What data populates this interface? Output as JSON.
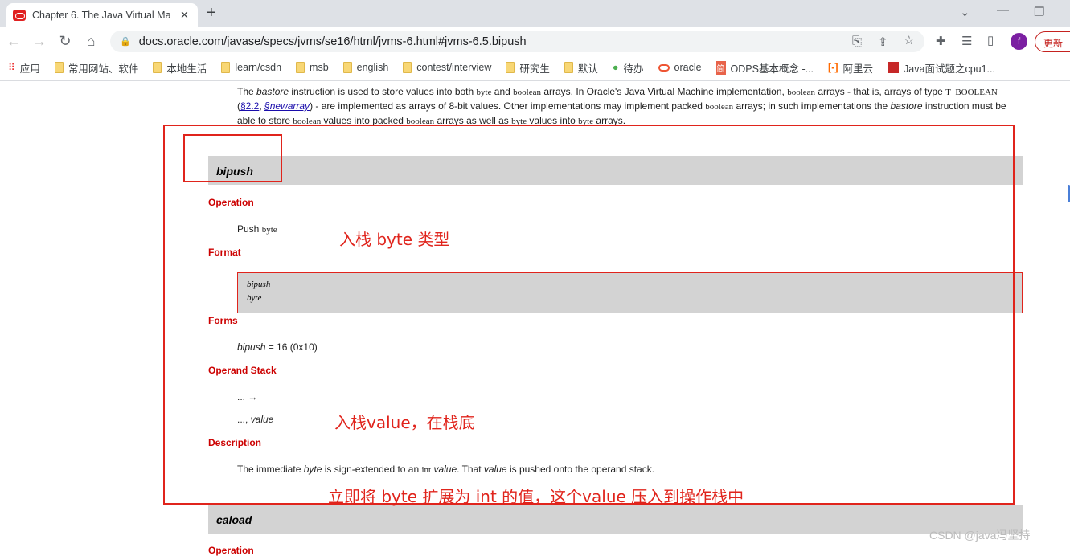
{
  "browser": {
    "tab_title": "Chapter 6. The Java Virtual Ma",
    "url": "docs.oracle.com/javase/specs/jvms/se16/html/jvms-6.html#jvms-6.5.bipush",
    "update_label": "更新",
    "profile_initial": "f",
    "bookmarks": [
      "应用",
      "常用网站、软件",
      "本地生活",
      "learn/csdn",
      "msb",
      "english",
      "contest/interview",
      "研究生",
      "默认",
      "待办",
      "oracle",
      "ODPS基本概念 -...",
      "阿里云",
      "Java面试题之cpu1..."
    ]
  },
  "page": {
    "intro": {
      "p1": "The ",
      "i1": "bastore",
      "p2": " instruction is used to store values into both ",
      "c1": "byte",
      "p3": " and ",
      "c2": "boolean",
      "p4": " arrays. In Oracle's Java Virtual Machine implementation, ",
      "c3": "boolean",
      "p5": " arrays - that is, arrays of type ",
      "c4": "T_BOOLEAN",
      "p6": " (",
      "l1": "§2.2",
      "p7": ", ",
      "l2": "§newarray",
      "p8": ") - are implemented as arrays of 8-bit values. Other implementations may implement packed ",
      "c5": "boolean",
      "p9": " arrays; in such implementations the ",
      "i2": "bastore",
      "p10": " instruction must be able to store ",
      "c6": "boolean",
      "p11": " values into packed ",
      "c7": "boolean",
      "p12": " arrays as well as ",
      "c8": "byte",
      "p13": " values into ",
      "c9": "byte",
      "p14": " arrays."
    },
    "section_title": "bipush",
    "operation_heading": "Operation",
    "operation_text": "Push ",
    "operation_code": "byte",
    "format_heading": "Format",
    "format_lines": [
      "bipush",
      "byte"
    ],
    "forms_heading": "Forms",
    "forms_name": "bipush",
    "forms_value": " = 16 (0x10)",
    "stack_heading": "Operand Stack",
    "stack_before": "... →",
    "stack_after_prefix": "..., ",
    "stack_after_value": "value",
    "description_heading": "Description",
    "desc": {
      "a": "The immediate ",
      "b": "byte",
      "c": " is sign-extended to an ",
      "d": "int",
      "e": " ",
      "f": "value",
      "g": ". That ",
      "h": "value",
      "i": " is pushed onto the operand stack."
    },
    "next_section_title": "caload",
    "next_heading": "Operation"
  },
  "annotations": {
    "a1": "入栈 byte 类型",
    "a2": "入栈value，在栈底",
    "a3": "立即将 byte 扩展为 int 的值，这个value 压入到操作栈中",
    "color": "#e0241c"
  },
  "watermark": "CSDN @java冯坚持"
}
